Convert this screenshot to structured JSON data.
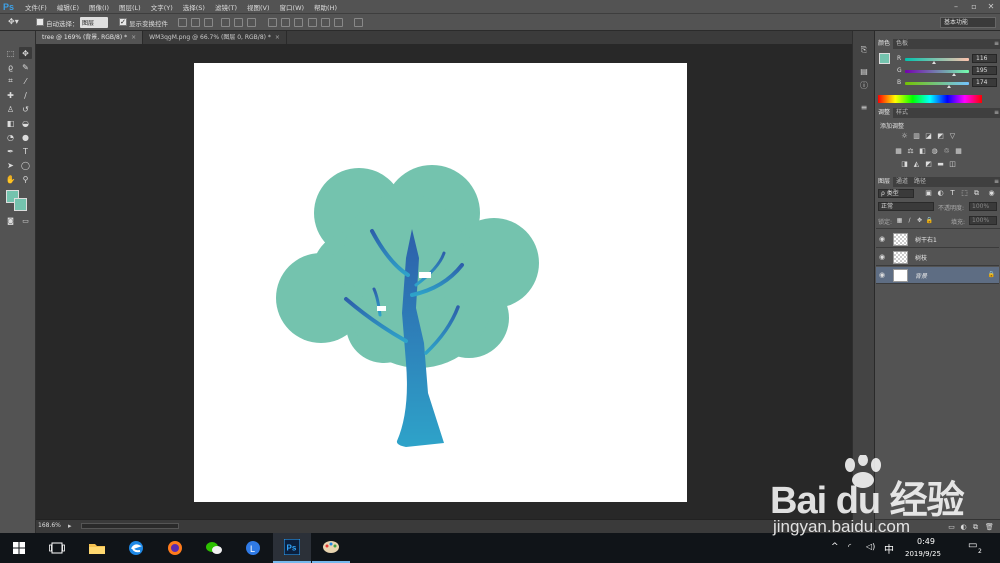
{
  "app": {
    "logo": "Ps"
  },
  "menu": [
    "文件(F)",
    "编辑(E)",
    "图像(I)",
    "图层(L)",
    "文字(Y)",
    "选择(S)",
    "滤镜(T)",
    "视图(V)",
    "窗口(W)",
    "帮助(H)"
  ],
  "options": {
    "auto_select_label": "自动选择：",
    "auto_select_value": "图层",
    "show_transform_label": "显示变换控件",
    "workspace": "基本功能"
  },
  "tabs": [
    {
      "label": "tree @ 169% (背景, RGB/8) *",
      "active": true
    },
    {
      "label": "WM3qgM.png @ 66.7% (图层 0, RGB/8) *",
      "active": false
    }
  ],
  "status": {
    "zoom": "168.6%"
  },
  "color_panel": {
    "tabs": [
      "颜色",
      "色板"
    ],
    "r": {
      "label": "R",
      "value": "116",
      "fraction": 0.455
    },
    "g": {
      "label": "G",
      "value": "195",
      "fraction": 0.765
    },
    "b": {
      "label": "B",
      "value": "174",
      "fraction": 0.682
    },
    "foreground": "#74c3ae"
  },
  "adjust_panel": {
    "tabs": [
      "调整",
      "样式"
    ],
    "title": "添加调整"
  },
  "layers_panel": {
    "tabs": [
      "图层",
      "通道",
      "路径"
    ],
    "filter_kind": "ρ 类型",
    "blend_mode": "正常",
    "opacity_label": "不透明度:",
    "opacity_value": "100%",
    "lock_label": "锁定:",
    "fill_label": "填充:",
    "fill_value": "100%",
    "layers": [
      {
        "name": "树干右1",
        "selected": false,
        "locked": false
      },
      {
        "name": "树枝",
        "selected": false,
        "locked": false
      },
      {
        "name": "背景",
        "selected": true,
        "locked": true
      }
    ]
  },
  "taskbar": {
    "time": "0:49",
    "date": "2019/9/25",
    "ime": "中",
    "notify_count": "2"
  },
  "watermark": {
    "logo": "Bai du 经验",
    "url": "jingyan.baidu.com"
  },
  "colors": {
    "foliage": "#74c3ae",
    "trunk_top": "#2d5faa",
    "trunk_bottom": "#2ea3c9"
  }
}
